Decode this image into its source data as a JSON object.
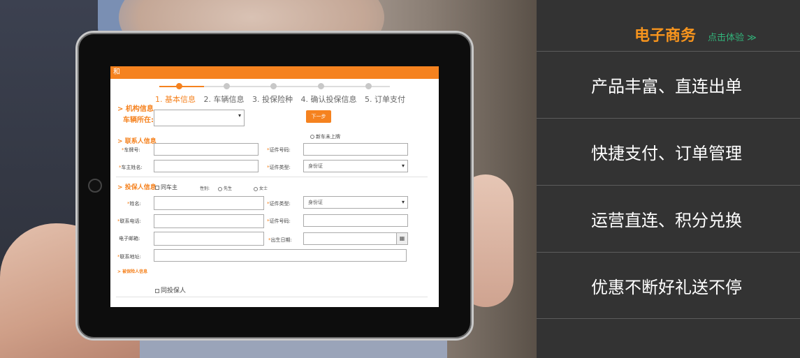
{
  "form": {
    "topbar_title": "和",
    "steps": [
      "1. 基本信息",
      "2. 车辆信息",
      "3. 投保险种",
      "4. 确认投保信息",
      "5. 订单支付"
    ],
    "org_section": "机构信息",
    "vehicle_location_label": "车辆所在:",
    "next_button": "下一步",
    "new_vehicle_option": "新车未上牌",
    "contact_section": "联系人信息",
    "plate_label": "车牌号:",
    "id_number_label": "证件号码:",
    "owner_name_label": "车主姓名:",
    "id_type_label": "证件类型:",
    "id_type_value": "身份证",
    "insured_section": "投保人信息",
    "same_as_owner": "同车主",
    "gender_label": "性别:",
    "gender_male": "先生",
    "gender_female": "女士",
    "name_label": "姓名:",
    "insured_id_type_label": "证件类型:",
    "insured_id_type_value": "身份证",
    "phone_label": "联系电话:",
    "insured_id_number_label": "证件号码:",
    "email_label": "电子邮箱:",
    "birth_label": "出生日期:",
    "address_label": "联系地址:",
    "beneficiary_section": "被保险人信息",
    "same_as_applicant": "同投保人"
  },
  "panel": {
    "brand": "电子商务",
    "cta": "点击体验 ≫",
    "features": [
      "产品丰富、直连出单",
      "快捷支付、订单管理",
      "运营直连、积分兑换",
      "优惠不断好礼送不停"
    ],
    "brand_color": "#f7941d",
    "cta_color": "#32b37a",
    "accent": "#f5821f"
  }
}
